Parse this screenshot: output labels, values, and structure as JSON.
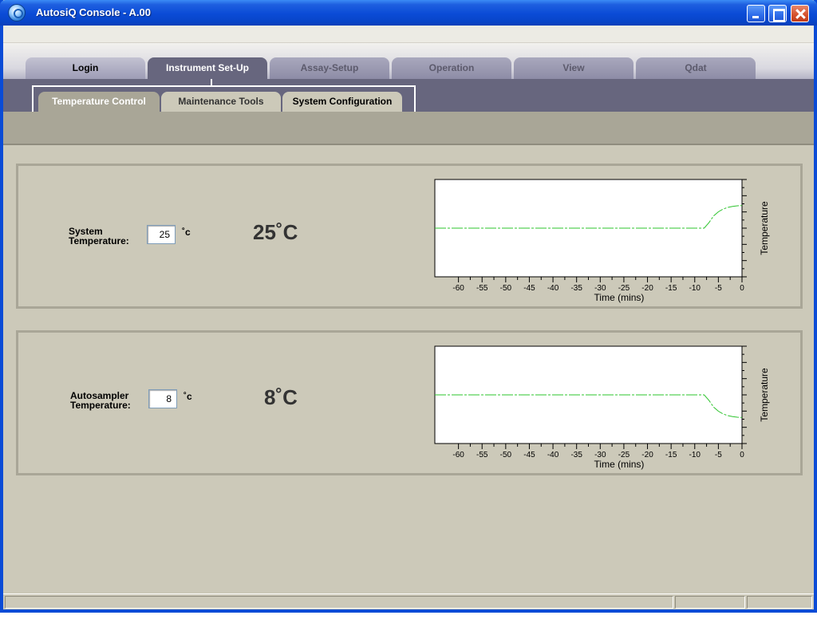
{
  "window": {
    "title": "AutosiQ Console - A.00"
  },
  "main_tabs": [
    "Login",
    "Instrument Set-Up",
    "Assay-Setup",
    "Operation",
    "View",
    "Qdat"
  ],
  "sub_tabs": [
    "Temperature Control",
    "Maintenance Tools",
    "System Configuration"
  ],
  "system": {
    "label_line1": "System",
    "label_line2": "Temperature:",
    "setpoint": "25",
    "unit": "˚c",
    "reading": "25˚C"
  },
  "autosampler": {
    "label_line1": "Autosampler",
    "label_line2": "Temperature:",
    "setpoint": "8",
    "unit": "˚c",
    "reading": "8˚C"
  },
  "colors": {
    "title_bar": "#0a4bd6",
    "active_tab": "#67667e",
    "trace": "#2ec42e",
    "panel": "#ccc9b9"
  },
  "chart_data": [
    {
      "type": "line",
      "xlabel": "Time (mins)",
      "ylabel": "Temperature",
      "xlim": [
        -65,
        0
      ],
      "x_ticks": [
        "-60",
        "-55",
        "-50",
        "-45",
        "-40",
        "-35",
        "-30",
        "-25",
        "-20",
        "-15",
        "-10",
        "-5",
        "0"
      ],
      "series": [
        {
          "x": [
            -65,
            -10,
            -8,
            -7,
            -6,
            -5,
            -4,
            -3,
            -2,
            -1,
            0
          ],
          "y": [
            0.0,
            0.0,
            0.0,
            0.2,
            0.45,
            0.6,
            0.7,
            0.76,
            0.8,
            0.82,
            0.83
          ]
        }
      ]
    },
    {
      "type": "line",
      "xlabel": "Time (mins)",
      "ylabel": "Temperature",
      "xlim": [
        -65,
        0
      ],
      "x_ticks": [
        "-60",
        "-55",
        "-50",
        "-45",
        "-40",
        "-35",
        "-30",
        "-25",
        "-20",
        "-15",
        "-10",
        "-5",
        "0"
      ],
      "series": [
        {
          "x": [
            -65,
            -10,
            -8,
            -7,
            -6,
            -5,
            -4,
            -3,
            -2,
            -1,
            0
          ],
          "y": [
            0.0,
            0.0,
            0.0,
            -0.2,
            -0.45,
            -0.6,
            -0.7,
            -0.76,
            -0.8,
            -0.82,
            -0.83
          ]
        }
      ]
    }
  ]
}
